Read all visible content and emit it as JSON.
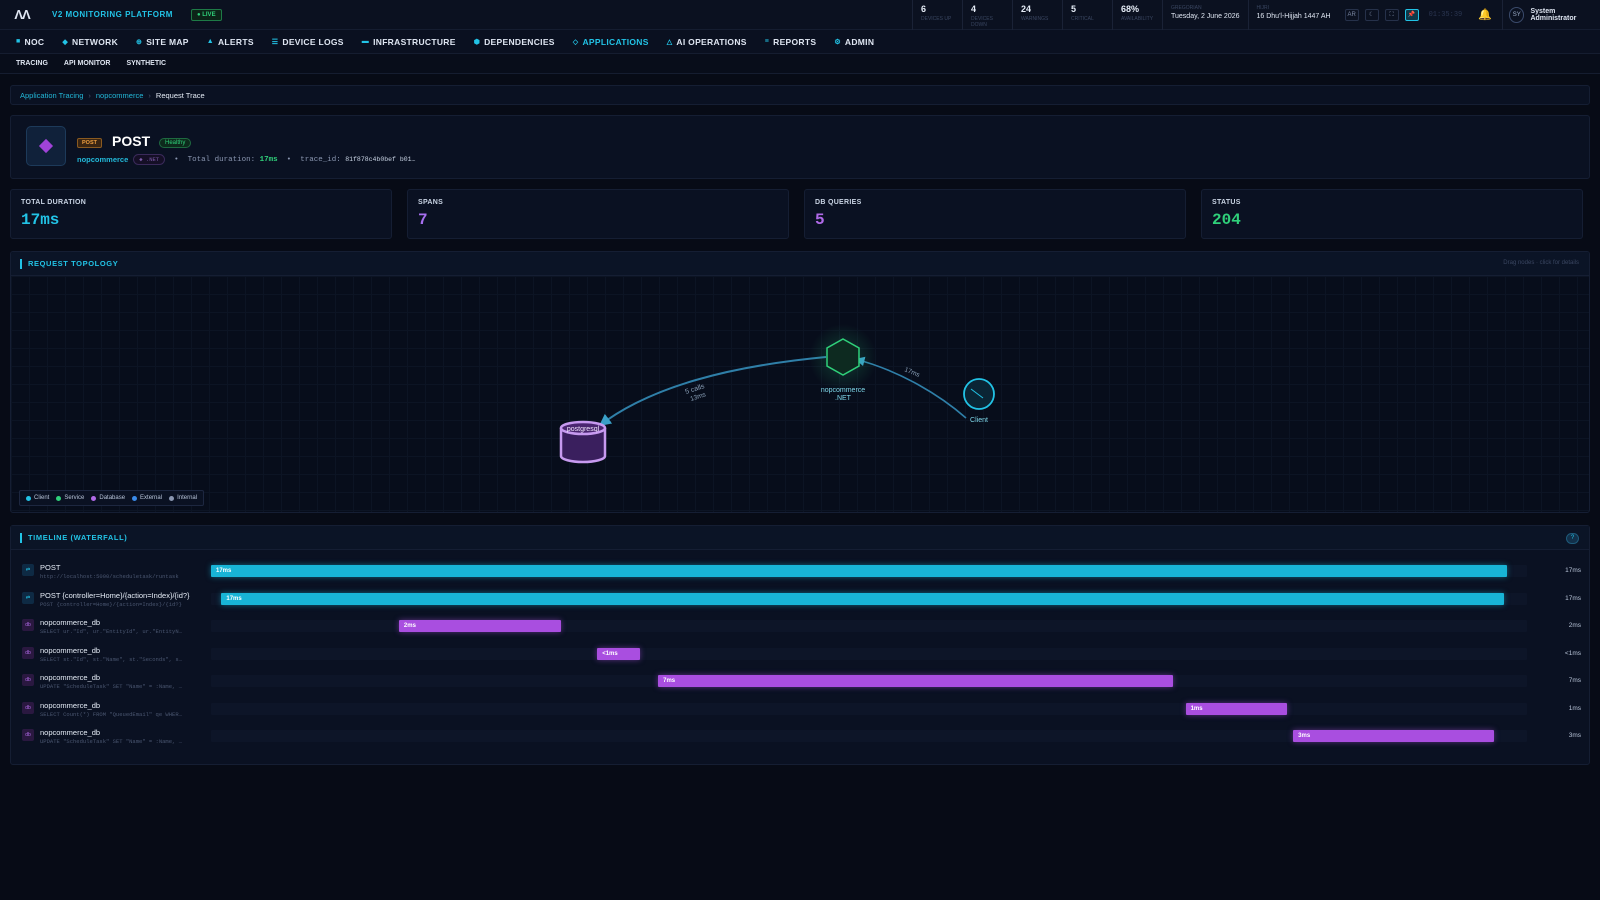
{
  "topbar": {
    "logo": "ΛΛ",
    "brand": "V2 MONITORING PLATFORM",
    "live": "● LIVE",
    "stats": [
      {
        "value": "6",
        "label": "DEVICES UP"
      },
      {
        "value": "4",
        "label": "DEVICES DOWN"
      },
      {
        "value": "24",
        "label": "WARNINGS"
      },
      {
        "value": "5",
        "label": "CRITICAL"
      },
      {
        "value": "68%",
        "label": "AVAILABILITY"
      }
    ],
    "gregorian_label": "GREGORIAN",
    "gregorian_date": "Tuesday, 2 June 2026",
    "hijri_label": "HIJRI",
    "hijri_date": "16 Dhu'l-Hijjah 1447 AH",
    "btn_ar": "AR",
    "btn_theme": "☾",
    "btn_fullscreen": "⛶",
    "btn_pin": "📌",
    "clock": "01:35:39",
    "bell": "🔔",
    "avatar": "SY",
    "user": "System Administrator"
  },
  "nav": [
    {
      "icon": "■",
      "label": "NOC"
    },
    {
      "icon": "◆",
      "label": "NETWORK"
    },
    {
      "icon": "⊕",
      "label": "SITE MAP"
    },
    {
      "icon": "▲",
      "label": "ALERTS"
    },
    {
      "icon": "☰",
      "label": "DEVICE LOGS"
    },
    {
      "icon": "▬",
      "label": "INFRASTRUCTURE"
    },
    {
      "icon": "⬢",
      "label": "DEPENDENCIES"
    },
    {
      "icon": "◇",
      "label": "APPLICATIONS",
      "active": true
    },
    {
      "icon": "△",
      "label": "AI OPERATIONS"
    },
    {
      "icon": "≡",
      "label": "REPORTS"
    },
    {
      "icon": "⚙",
      "label": "ADMIN"
    }
  ],
  "subnav": [
    "TRACING",
    "API MONITOR",
    "SYNTHETIC"
  ],
  "breadcrumb": {
    "items": [
      "Application Tracing",
      "nopcommerce"
    ],
    "current": "Request Trace",
    "sep": "›"
  },
  "header": {
    "method_badge": "POST",
    "title": "POST",
    "health": "Healthy",
    "service": "nopcommerce",
    "framework": "◆ .NET",
    "duration_label": "Total duration:",
    "duration": "17ms",
    "trace_label": "trace_id:",
    "trace_id": "81f878c4b0bef b01…",
    "dot": "•"
  },
  "kpis": [
    {
      "label": "TOTAL DURATION",
      "value": "17ms",
      "color": "#22c3e6"
    },
    {
      "label": "SPANS",
      "value": "7",
      "color": "#a76ff0"
    },
    {
      "label": "DB QUERIES",
      "value": "5",
      "color": "#b06ae8"
    },
    {
      "label": "STATUS",
      "value": "204",
      "color": "#2fd07a"
    }
  ],
  "topology": {
    "title": "REQUEST TOPOLOGY",
    "hint": "Drag nodes · click for details",
    "nodes": {
      "service_line1": "nopcommerce",
      "service_line2": ".NET",
      "client": "Client",
      "database": "postgresql"
    },
    "edges": {
      "db_calls": "5 calls",
      "db_duration": "13ms",
      "client_duration": "17ms"
    },
    "legend": [
      {
        "label": "Client",
        "color": "#22c3e6"
      },
      {
        "label": "Service",
        "color": "#2fd07a"
      },
      {
        "label": "Database",
        "color": "#b06ae8"
      },
      {
        "label": "External",
        "color": "#3a8ae8"
      },
      {
        "label": "Internal",
        "color": "#8a96b0"
      }
    ]
  },
  "waterfall": {
    "title": "TIMELINE (WATERFALL)",
    "help": "?",
    "total_ms": 17,
    "rows": [
      {
        "kind": "http",
        "icon": "⇄",
        "name": "POST",
        "sub": "http://localhost:5000/scheduletask/runtask",
        "bar_label": "17ms",
        "duration": "17ms",
        "start_frac": 0.0,
        "width_frac": 1.0
      },
      {
        "kind": "http",
        "icon": "⇄",
        "name": "POST {controller=Home}/{action=Index}/{id?}",
        "sub": "POST {controller=Home}/{action=Index}/{id?}",
        "bar_label": "17ms",
        "duration": "17ms",
        "start_frac": 0.008,
        "width_frac": 0.99
      },
      {
        "kind": "db",
        "icon": "db",
        "name": "nopcommerce_db",
        "sub": "SELECT ur.\"Id\", ur.\"EntityId\", ur.\"EntityN…",
        "bar_label": "2ms",
        "duration": "2ms",
        "start_frac": 0.145,
        "width_frac": 0.125
      },
      {
        "kind": "db",
        "icon": "db",
        "name": "nopcommerce_db",
        "sub": "SELECT st.\"Id\", st.\"Name\", st.\"Seconds\", s…",
        "bar_label": "<1ms",
        "duration": "<1ms",
        "start_frac": 0.298,
        "width_frac": 0.033
      },
      {
        "kind": "db",
        "icon": "db",
        "name": "nopcommerce_db",
        "sub": "UPDATE \"ScheduleTask\" SET \"Name\" = :Name, …",
        "bar_label": "7ms",
        "duration": "7ms",
        "start_frac": 0.345,
        "width_frac": 0.397
      },
      {
        "kind": "db",
        "icon": "db",
        "name": "nopcommerce_db",
        "sub": "SELECT Count(*) FROM \"QueuedEmail\" qe WHER…",
        "bar_label": "1ms",
        "duration": "1ms",
        "start_frac": 0.752,
        "width_frac": 0.078
      },
      {
        "kind": "db",
        "icon": "db",
        "name": "nopcommerce_db",
        "sub": "UPDATE \"ScheduleTask\" SET \"Name\" = :Name, …",
        "bar_label": "3ms",
        "duration": "3ms",
        "start_frac": 0.835,
        "width_frac": 0.155
      }
    ]
  }
}
